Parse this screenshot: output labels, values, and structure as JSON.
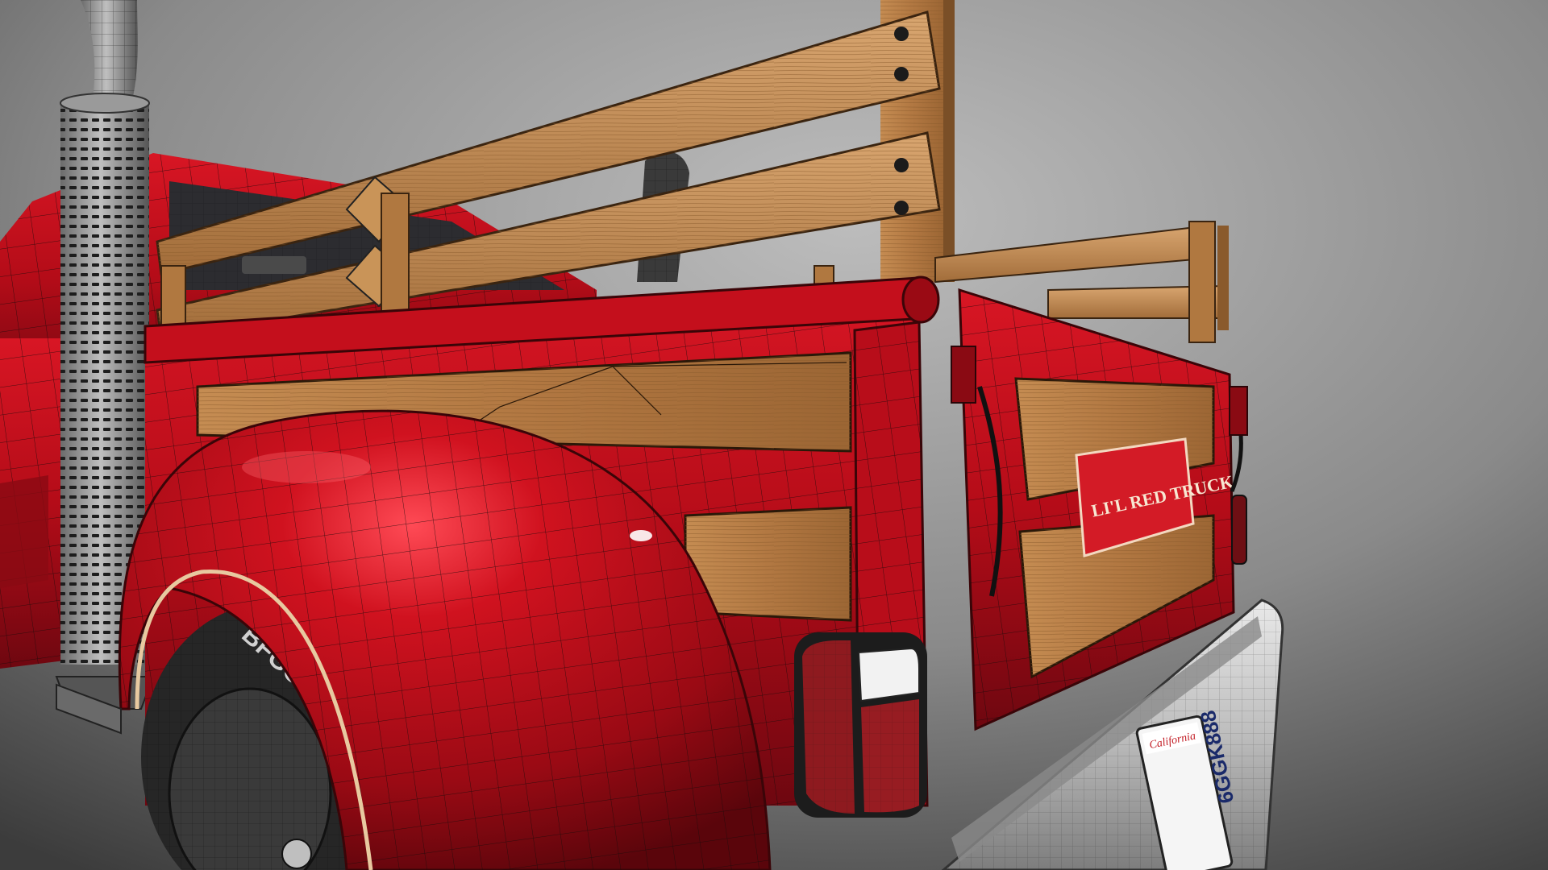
{
  "scene": {
    "subject": "truck-3d-wireframe-render",
    "colors": {
      "background_light": "#b7b7b7",
      "background_dark": "#3f3f3f",
      "body_red": "#c8101e",
      "body_red_dark": "#7a0810",
      "wood": "#b7804a",
      "wood_dark": "#7a4f27",
      "chrome": "#c9c9c9",
      "tire": "#2b2b2b",
      "taillight": "#8e1a1f",
      "wire": "#1a1a1a"
    }
  },
  "tailgate": {
    "decal_text": "LI'L RED TRUCK"
  },
  "license_plate": {
    "state": "California",
    "number": "6GGK888"
  },
  "tire": {
    "sidewall_text": "BFGOODRICH"
  }
}
